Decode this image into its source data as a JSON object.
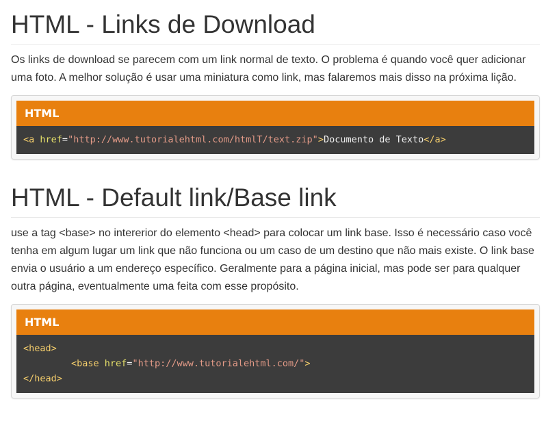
{
  "sections": [
    {
      "title": "HTML - Links de Download",
      "text": "Os links de download se parecem com um link normal de texto. O problema é quando você quer adicionar uma foto. A melhor solução é usar uma miniatura como link, mas falaremos mais disso na próxima lição.",
      "code_label": "HTML",
      "code": {
        "tag_open": "<a",
        "attr": "href",
        "eq": "=",
        "value": "\"http://www.tutorialehtml.com/htmlT/text.zip\"",
        "close_bracket": ">",
        "text": "Documento de Texto",
        "tag_close": "</a>"
      }
    },
    {
      "title": "HTML - Default link/Base link",
      "text": "use a tag <base> no intererior do elemento <head> para colocar um link base. Isso é necessário caso você tenha em algum lugar um link que não funciona ou um caso de um destino que não mais existe. O link base envia o usuário a um endereço específico. Geralmente para a página inicial, mas pode ser para qualquer outra página, eventualmente uma feita com esse propósito.",
      "code_label": "HTML",
      "code": {
        "line1": "<head>",
        "line2_tag_open": "<base",
        "line2_attr": "href",
        "line2_eq": "=",
        "line2_value": "\"http://www.tutorialehtml.com/\"",
        "line2_close": ">",
        "line3": "</head>"
      }
    }
  ],
  "colors": {
    "header_bg": "#e8800f",
    "code_bg": "#3c3c3c",
    "tag": "#f6cf6c",
    "string": "#e49b88",
    "text": "#333333"
  }
}
